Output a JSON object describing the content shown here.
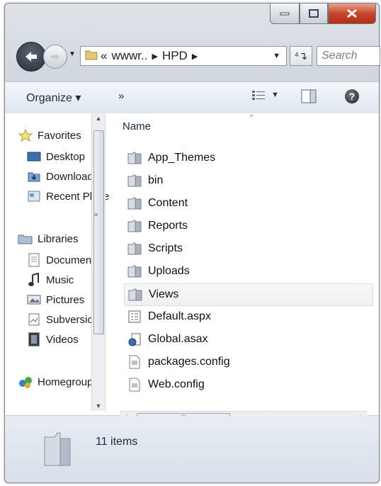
{
  "window": {
    "address": {
      "crumbs": [
        "«",
        "wwwr..",
        "HPD"
      ]
    },
    "search_placeholder": "Search",
    "toolbar": {
      "organize_label": "Organize ▾",
      "more_label": "»"
    }
  },
  "nav_pane": {
    "items": [
      {
        "label": "Favorites",
        "icon": "star-icon"
      },
      {
        "label": "Desktop",
        "icon": "desktop-icon"
      },
      {
        "label": "Downloads",
        "icon": "downloads-icon"
      },
      {
        "label": "Recent Places",
        "icon": "recent-places-icon"
      },
      {
        "label": "Libraries",
        "icon": "libraries-icon"
      },
      {
        "label": "Documents",
        "icon": "documents-icon"
      },
      {
        "label": "Music",
        "icon": "music-icon"
      },
      {
        "label": "Pictures",
        "icon": "pictures-icon"
      },
      {
        "label": "Subversion",
        "icon": "subversion-icon"
      },
      {
        "label": "Videos",
        "icon": "videos-icon"
      },
      {
        "label": "Homegroup",
        "icon": "homegroup-icon"
      }
    ]
  },
  "file_list": {
    "column_header": "Name",
    "files": [
      {
        "name": "App_Themes",
        "type": "folder"
      },
      {
        "name": "bin",
        "type": "folder"
      },
      {
        "name": "Content",
        "type": "folder"
      },
      {
        "name": "Reports",
        "type": "folder"
      },
      {
        "name": "Scripts",
        "type": "folder"
      },
      {
        "name": "Uploads",
        "type": "folder"
      },
      {
        "name": "Views",
        "type": "folder"
      },
      {
        "name": "Default.aspx",
        "type": "aspx"
      },
      {
        "name": "Global.asax",
        "type": "asax"
      },
      {
        "name": "packages.config",
        "type": "config"
      },
      {
        "name": "Web.config",
        "type": "config"
      }
    ]
  },
  "status": {
    "item_count": "11 items"
  }
}
